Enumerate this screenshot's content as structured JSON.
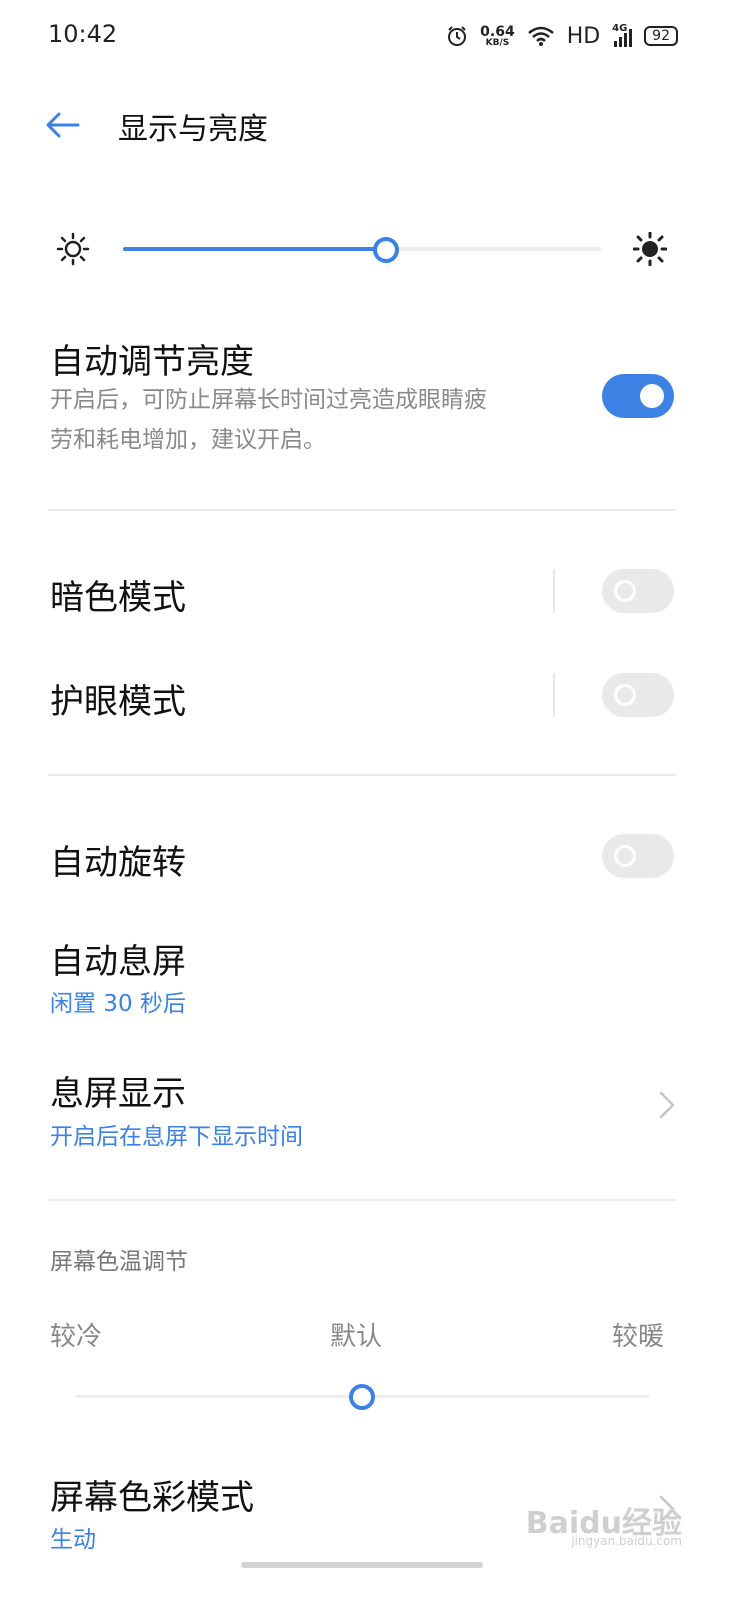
{
  "status": {
    "time": "10:42",
    "speed_value": "0.64",
    "speed_unit": "KB/S",
    "hd": "HD",
    "network": "4G",
    "battery": "92",
    "icons": [
      "alarm-icon",
      "wifi-icon",
      "signal-icon",
      "battery-icon"
    ]
  },
  "header": {
    "title": "显示与亮度",
    "back_icon": "arrow-left-icon"
  },
  "brightness": {
    "level": 0.55,
    "min_icon": "sun-small-icon",
    "max_icon": "sun-large-icon"
  },
  "auto_brightness": {
    "title": "自动调节亮度",
    "desc_line1": "开启后，可防止屏幕长时间过亮造成眼睛疲",
    "desc_line2": "劳和耗电增加，建议开启。",
    "enabled": true
  },
  "dark_mode": {
    "title": "暗色模式",
    "enabled": false
  },
  "eye_care": {
    "title": "护眼模式",
    "enabled": false
  },
  "auto_rotate": {
    "title": "自动旋转",
    "enabled": false
  },
  "screen_timeout": {
    "title": "自动息屏",
    "value": "闲置 30 秒后"
  },
  "aod": {
    "title": "息屏显示",
    "value": "开启后在息屏下显示时间"
  },
  "color_temp": {
    "section_title": "屏幕色温调节",
    "cool": "较冷",
    "default": "默认",
    "warm": "较暖",
    "level": 0.5
  },
  "color_mode": {
    "title": "屏幕色彩模式",
    "value": "生动"
  },
  "watermark": {
    "text": "Baidu经验",
    "sub": "jingyan.baidu.com"
  },
  "colors": {
    "accent": "#3b82e4",
    "divider": "#ebebeb"
  }
}
